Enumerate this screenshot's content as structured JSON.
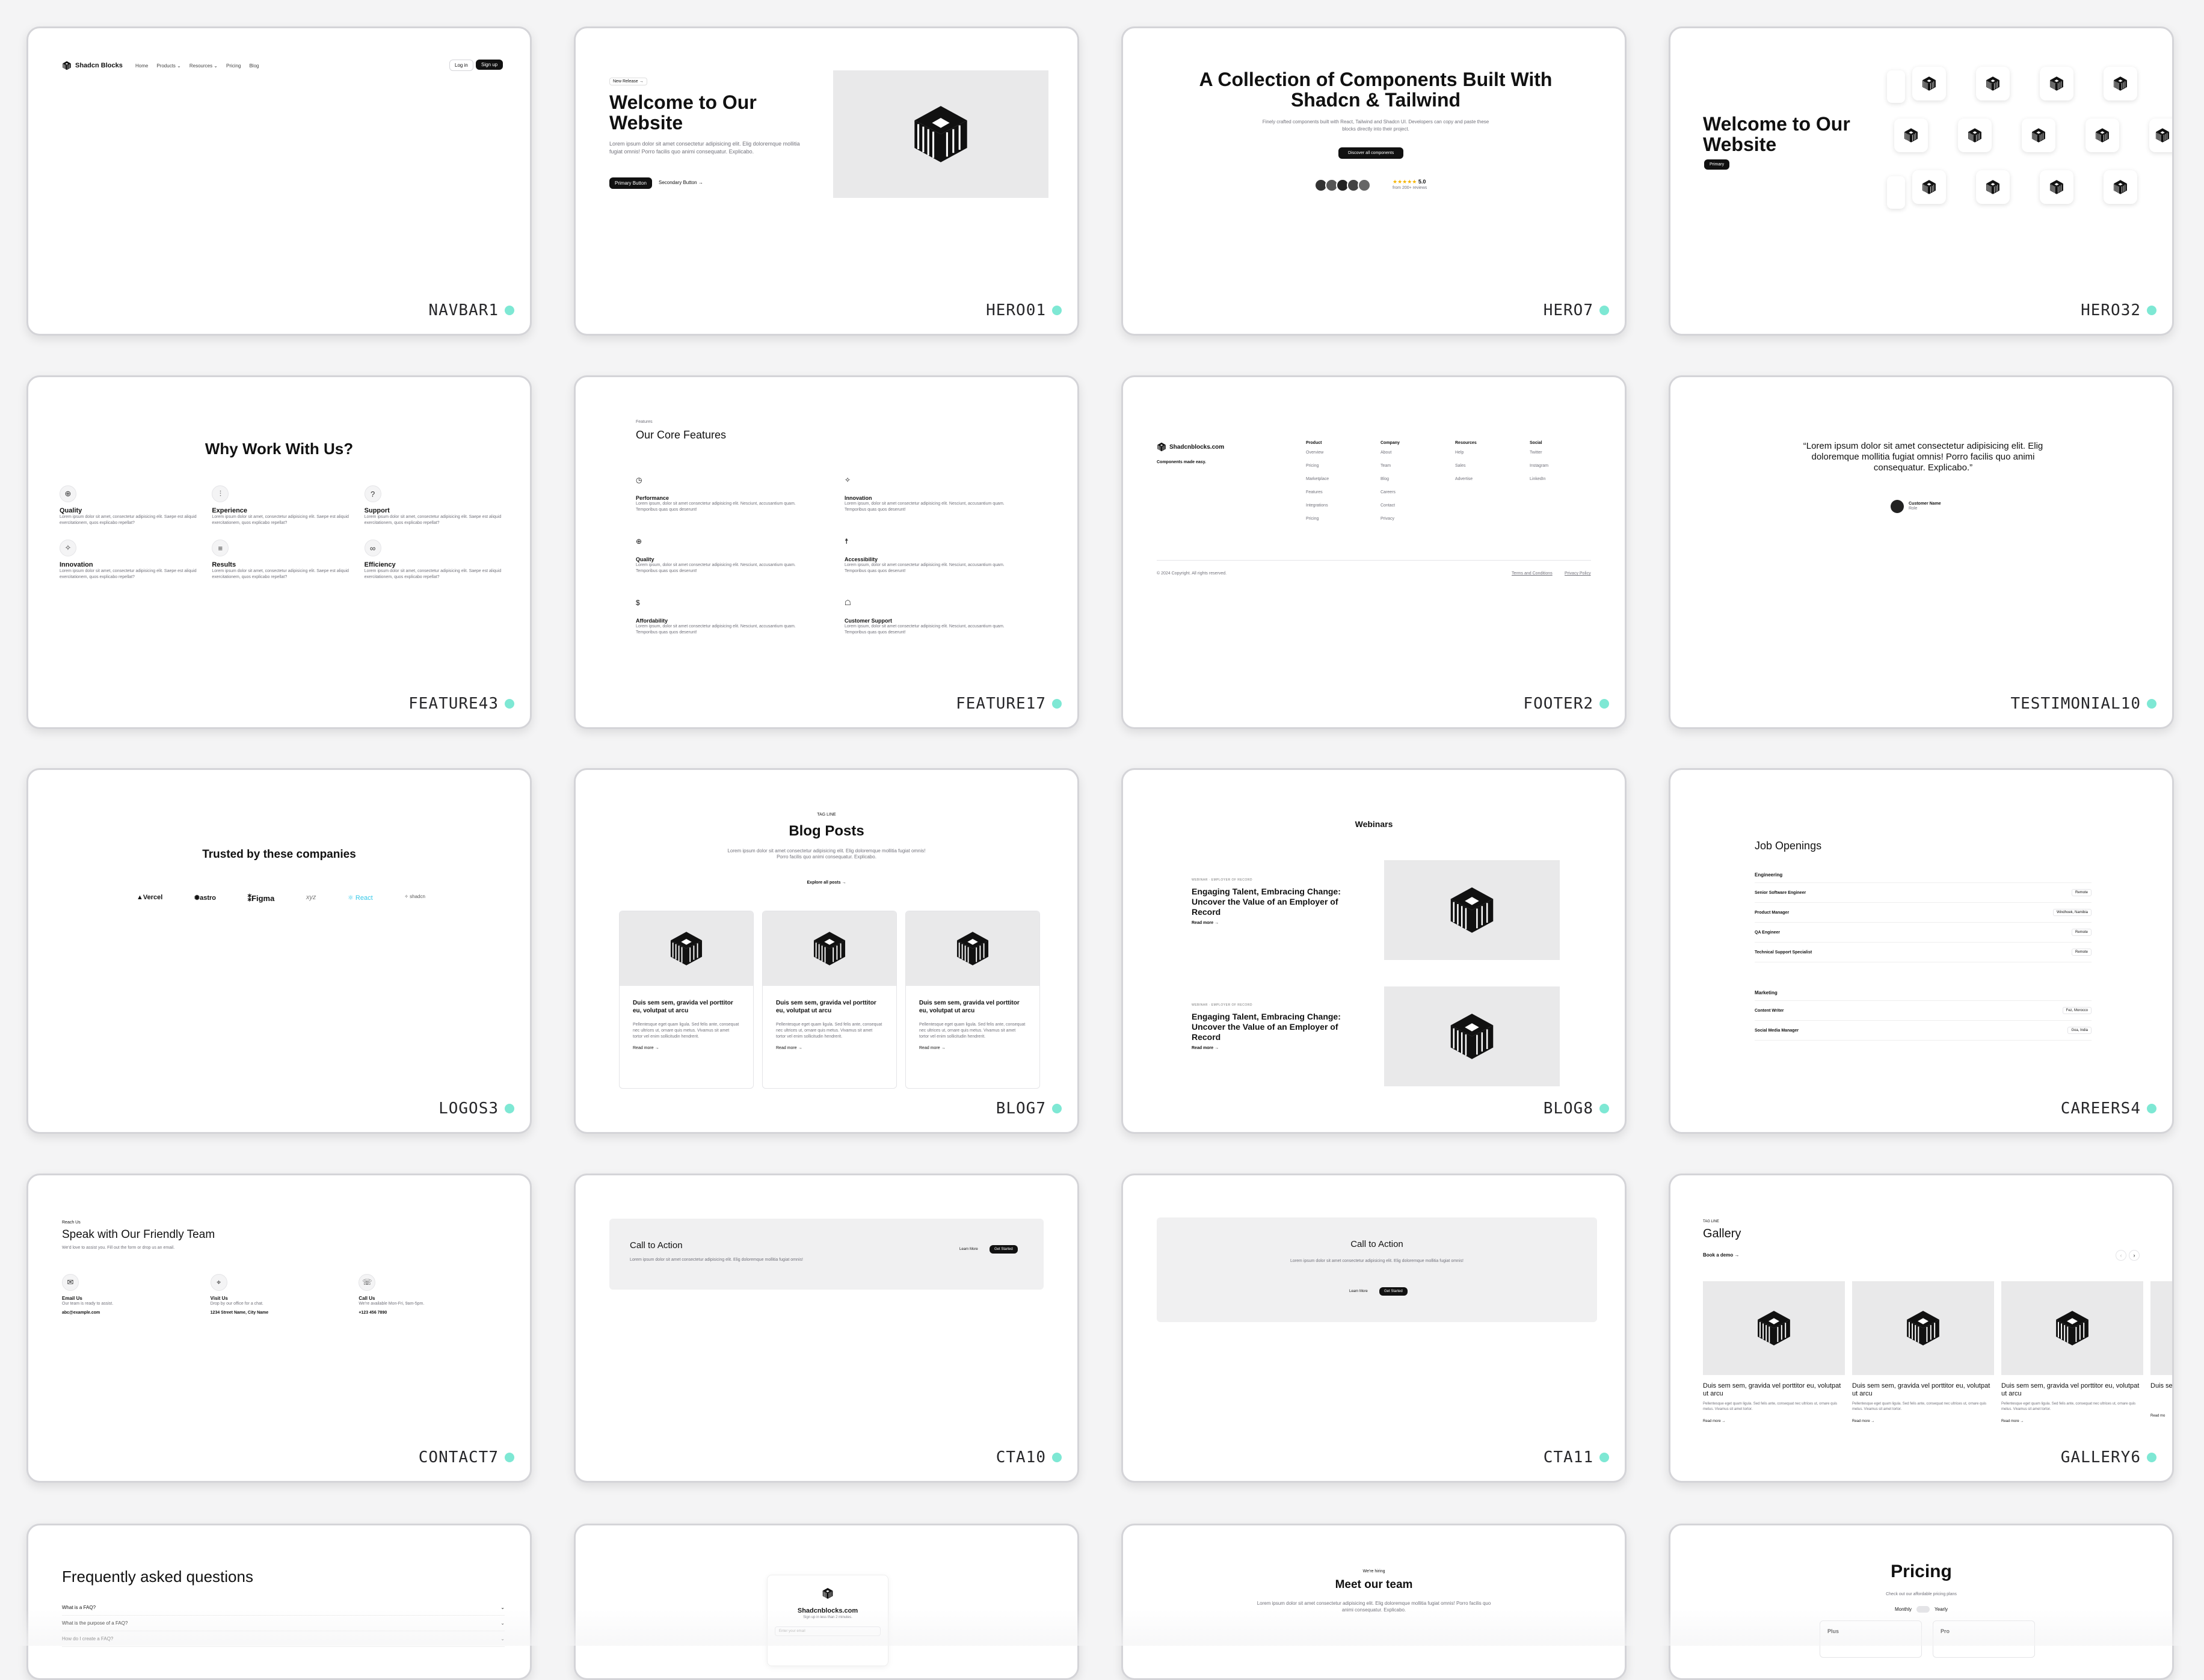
{
  "cards": {
    "navbar1": {
      "label": "NAVBAR1",
      "brand": "Shadcn Blocks",
      "links": [
        "Home",
        "Products ⌄",
        "Resources ⌄",
        "Pricing",
        "Blog"
      ],
      "login": "Log in",
      "signup": "Sign up"
    },
    "hero1": {
      "label": "HERO01",
      "badge": "New Release →",
      "title": "Welcome to Our Website",
      "desc": "Lorem ipsum dolor sit amet consectetur adipisicing elit. Elig doloremque mollitia fugiat omnis! Porro facilis quo animi consequatur. Explicabo.",
      "primary": "Primary Button",
      "secondary": "Secondary Button →"
    },
    "hero7": {
      "label": "HERO7",
      "title": "A Collection of Components Built With Shadcn & Tailwind",
      "desc": "Finely crafted components built with React, Tailwind and Shadcn UI. Developers can copy and paste these blocks directly into their project.",
      "cta": "Discover all components",
      "stars": "★★★★★",
      "rating": "5.0",
      "reviews": "from 200+ reviews"
    },
    "hero32": {
      "label": "HERO32",
      "title": "Welcome to Our Website",
      "cta": "Primary"
    },
    "feature43": {
      "label": "FEATURE43",
      "title": "Why Work With Us?",
      "items": [
        {
          "title": "Quality",
          "desc": "Lorem ipsum dolor sit amet, consectetur adipisicing elit. Saepe est aliquid exercitationem, quos explicabo repellat?"
        },
        {
          "title": "Experience",
          "desc": "Lorem ipsum dolor sit amet, consectetur adipisicing elit. Saepe est aliquid exercitationem, quos explicabo repellat?"
        },
        {
          "title": "Support",
          "desc": "Lorem ipsum dolor sit amet, consectetur adipisicing elit. Saepe est aliquid exercitationem, quos explicabo repellat?"
        },
        {
          "title": "Innovation",
          "desc": "Lorem ipsum dolor sit amet, consectetur adipisicing elit. Saepe est aliquid exercitationem, quos explicabo repellat?"
        },
        {
          "title": "Results",
          "desc": "Lorem ipsum dolor sit amet, consectetur adipisicing elit. Saepe est aliquid exercitationem, quos explicabo repellat?"
        },
        {
          "title": "Efficiency",
          "desc": "Lorem ipsum dolor sit amet, consectetur adipisicing elit. Saepe est aliquid exercitationem, quos explicabo repellat?"
        }
      ]
    },
    "feature17": {
      "label": "FEATURE17",
      "eyebrow": "Features",
      "title": "Our Core Features",
      "items": [
        {
          "title": "Performance",
          "desc": "Lorem ipsum, dolor sit amet consectetur adipisicing elit. Nesciunt, accusantium quam. Temporibus quas quos deserunt!"
        },
        {
          "title": "Innovation",
          "desc": "Lorem ipsum, dolor sit amet consectetur adipisicing elit. Nesciunt, accusantium quam. Temporibus quas quos deserunt!"
        },
        {
          "title": "Quality",
          "desc": "Lorem ipsum, dolor sit amet consectetur adipisicing elit. Nesciunt, accusantium quam. Temporibus quas quos deserunt!"
        },
        {
          "title": "Accessibility",
          "desc": "Lorem ipsum, dolor sit amet consectetur adipisicing elit. Nesciunt, accusantium quam. Temporibus quas quos deserunt!"
        },
        {
          "title": "Affordability",
          "desc": "Lorem ipsum, dolor sit amet consectetur adipisicing elit. Nesciunt, accusantium quam. Temporibus quas quos deserunt!"
        },
        {
          "title": "Customer Support",
          "desc": "Lorem ipsum, dolor sit amet consectetur adipisicing elit. Nesciunt, accusantium quam. Temporibus quas quos deserunt!"
        }
      ]
    },
    "footer2": {
      "label": "FOOTER2",
      "brand": "Shadcnblocks.com",
      "tagline": "Components made easy.",
      "cols": [
        {
          "title": "Product",
          "links": [
            "Overview",
            "Pricing",
            "Marketplace",
            "Features",
            "Integrations",
            "Pricing"
          ]
        },
        {
          "title": "Company",
          "links": [
            "About",
            "Team",
            "Blog",
            "Careers",
            "Contact",
            "Privacy"
          ]
        },
        {
          "title": "Resources",
          "links": [
            "Help",
            "Sales",
            "Advertise"
          ]
        },
        {
          "title": "Social",
          "links": [
            "Twitter",
            "Instagram",
            "LinkedIn"
          ]
        }
      ],
      "copyright": "© 2024 Copyright. All rights reserved.",
      "terms": "Terms and Conditions",
      "privacy": "Privacy Policy"
    },
    "testimonial10": {
      "label": "TESTIMONIAL10",
      "quote": "“Lorem ipsum dolor sit amet consectetur adipisicing elit. Elig doloremque mollitia fugiat omnis! Porro facilis quo animi consequatur. Explicabo.”",
      "name": "Customer Name",
      "role": "Role"
    },
    "logos3": {
      "label": "LOGOS3",
      "title": "Trusted by these companies",
      "logos": [
        "▲Vercel",
        "✺astro",
        "⁑Figma",
        "xyz",
        "⚛ React",
        "✧ shadcn"
      ]
    },
    "blog7": {
      "label": "BLOG7",
      "tag": "TAG LINE",
      "title": "Blog Posts",
      "desc": "Lorem ipsum dolor sit amet consectetur adipisicing elit. Elig doloremque mollitia fugiat omnis! Porro facilis quo animi consequatur. Explicabo.",
      "explore": "Explore all posts →",
      "post_title": "Duis sem sem, gravida vel porttitor eu, volutpat ut arcu",
      "post_desc": "Pellentesque eget quam ligula. Sed felis ante, consequat nec ultrices ut, ornare quis metus. Vivamus sit amet tortor vel enim sollicitudin hendrerit.",
      "read_more": "Read more →"
    },
    "blog8": {
      "label": "BLOG8",
      "title": "Webinars",
      "meta": "WEBINAR  ·  EMPLOYER OF RECORD",
      "post_title": "Engaging Talent, Embracing Change: Uncover the Value of an Employer of Record",
      "read_more": "Read more →"
    },
    "careers4": {
      "label": "CAREERS4",
      "title": "Job Openings",
      "groups": [
        {
          "name": "Engineering",
          "jobs": [
            {
              "title": "Senior Software Engineer",
              "loc": "Remote"
            },
            {
              "title": "Product Manager",
              "loc": "Windhoek, Namibia"
            },
            {
              "title": "QA Engineer",
              "loc": "Remote"
            },
            {
              "title": "Technical Support Specialist",
              "loc": "Remote"
            }
          ]
        },
        {
          "name": "Marketing",
          "jobs": [
            {
              "title": "Content Writer",
              "loc": "Fez, Morocco"
            },
            {
              "title": "Social Media Manager",
              "loc": "Goa, India"
            }
          ]
        }
      ]
    },
    "contact7": {
      "label": "CONTACT7",
      "eyebrow": "Reach Us",
      "title": "Speak with Our Friendly Team",
      "desc": "We'd love to assist you. Fill out the form or drop us an email.",
      "items": [
        {
          "title": "Email Us",
          "desc": "Our team is ready to assist.",
          "value": "abc@example.com"
        },
        {
          "title": "Visit Us",
          "desc": "Drop by our office for a chat.",
          "value": "1234 Street Name, City Name"
        },
        {
          "title": "Call Us",
          "desc": "We're available Mon-Fri, 9am-5pm.",
          "value": "+123 456 7890"
        }
      ]
    },
    "cta10": {
      "label": "CTA10",
      "title": "Call to Action",
      "desc": "Lorem ipsum dolor sit amet consectetur adipisicing elit. Elig doloremque mollitia fugiat omnis!",
      "learn": "Learn More",
      "start": "Get Started"
    },
    "cta11": {
      "label": "CTA11",
      "title": "Call to Action",
      "desc": "Lorem ipsum dolor sit amet consectetur adipisicing elit. Elig doloremque mollitia fugiat omnis!",
      "learn": "Learn More",
      "start": "Get Started"
    },
    "gallery6": {
      "label": "GALLERY6",
      "tag": "TAG LINE",
      "title": "Gallery",
      "book": "Book a demo →",
      "item_title": "Duis sem sem, gravida vel porttitor eu, volutpat ut arcu",
      "item_desc": "Pellentesque eget quam ligula. Sed felis ante, consequat nec ultrices ut, ornare quis metus. Vivamus sit amet tortor.",
      "read_more": "Read more →",
      "partial_title": "Duis se",
      "partial_read": "Read mo"
    },
    "faq": {
      "title": "Frequently asked questions",
      "items": [
        "What is a FAQ?",
        "What is the purpose of a FAQ?",
        "How do I create a FAQ?"
      ]
    },
    "signup": {
      "brand": "Shadcnblocks.com",
      "desc": "Sign up in less than 2 minutes.",
      "placeholder": "Enter your email"
    },
    "team": {
      "eyebrow": "We're hiring",
      "title": "Meet our team",
      "desc": "Lorem ipsum dolor sit amet consectetur adipisicing elit. Elig doloremque mollitia fugiat omnis! Porro facilis quo animi consequatur. Explicabo."
    },
    "pricing": {
      "title": "Pricing",
      "desc": "Check out our affordable pricing plans",
      "monthly": "Monthly",
      "yearly": "Yearly",
      "plans": [
        "Plus",
        "Pro"
      ]
    }
  }
}
